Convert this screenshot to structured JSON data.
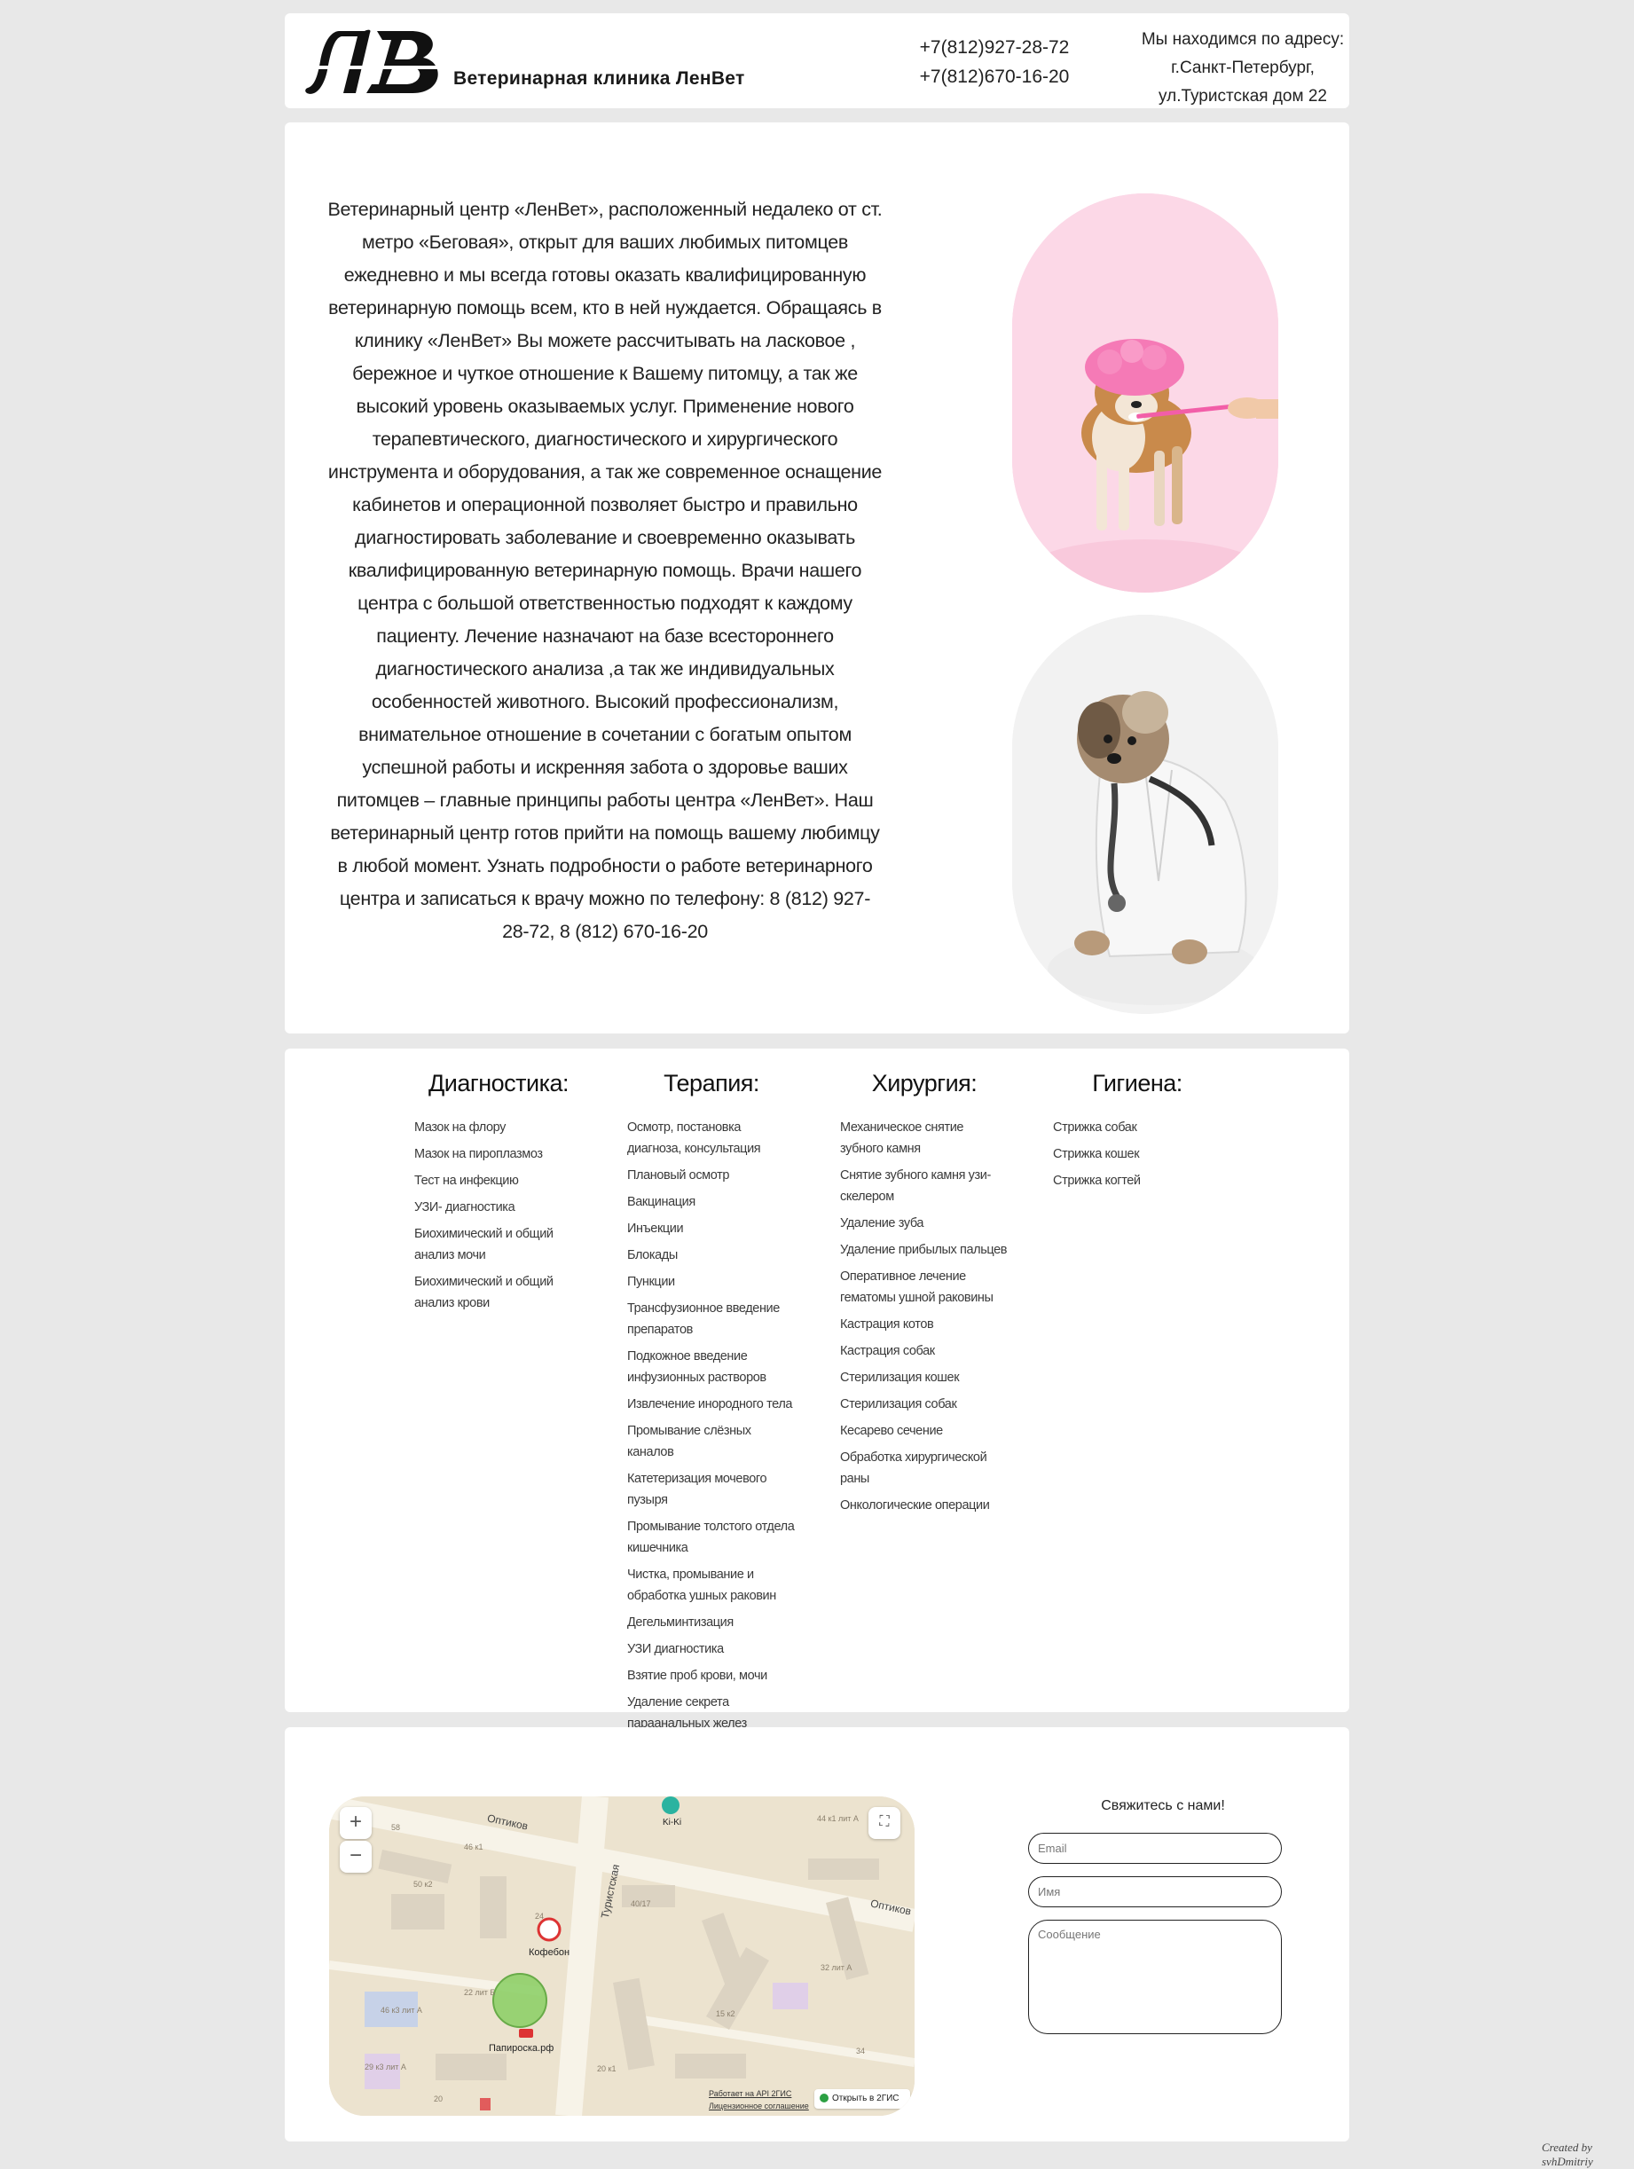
{
  "header": {
    "logo_letters": "ЛВ",
    "clinic_name": "Ветеринарная клиника ЛенВет",
    "phones": [
      "+7(812)927-28-72",
      "+7(812)670-16-20"
    ],
    "address": [
      "Мы находимся по адресу:",
      "г.Санкт-Петербург,",
      "ул.Туристская дом 22"
    ]
  },
  "about": {
    "text": "Ветеринарный центр «ЛенВет», расположенный недалеко от ст. метро «Беговая», открыт для ваших любимых питомцев ежедневно и мы всегда готовы оказать квалифицированную ветеринарную помощь всем, кто в ней нуждается. Обращаясь в клинику «ЛенВет» Вы можете рассчитывать на ласковое , бережное и чуткое отношение к Вашему питомцу, а так же высокий уровень оказываемых услуг. Применение нового терапевтического, диагностического и хирургического инструмента и оборудования, а так же современное оснащение кабинетов и операционной позволяет быстро и правильно диагностировать заболевание и своевременно оказывать квалифицированную ветеринарную помощь. Врачи нашего центра с большой ответственностью подходят к каждому пациенту. Лечение назначают на базе всестороннего диагностического анализа ,а так же индивидуальных особенностей животного. Высокий профессионализм, внимательное отношение в сочетании с богатым опытом успешной работы и искренняя забота о здоровье ваших питомцев – главные принципы работы центра «ЛенВет». Наш ветеринарный центр готов прийти на помощь вашему любимцу в любой момент. Узнать подробности о работе ветеринарного центра и записаться к врачу можно по телефону: 8 (812) 927-28-72, 8 (812) 670-16-20",
    "images": [
      "dog-brushing-teeth",
      "dog-in-doctor-coat"
    ]
  },
  "services": [
    {
      "title": "Диагностика:",
      "items": [
        "Мазок на флору",
        "Мазок на пироплазмоз",
        "Тест на инфекцию",
        "УЗИ- диагностика",
        "Биохимический и общий анализ мочи",
        "Биохимический и общий анализ крови"
      ]
    },
    {
      "title": "Терапия:",
      "items": [
        "Осмотр, постановка диагноза, консультация",
        "Плановый осмотр",
        "Вакцинация",
        "Инъекции",
        "Блокады",
        "Пункции",
        "Трансфузионное введение препаратов",
        "Подкожное введение инфузионных растворов",
        "Извлечение инородного тела",
        "Промывание слёзных каналов",
        "Катетеризация мочевого пузыря",
        "Промывание толстого отдела кишечника",
        "Чистка, промывание и обработка ушных раковин",
        "Дегельминтизация",
        "УЗИ диагностика",
        "Взятие проб крови, мочи",
        "Удаление секрета параанальных желез"
      ]
    },
    {
      "title": "Хирургия:",
      "items": [
        "Механическое снятие зубного камня",
        "Снятие зубного камня узи-скелером",
        "Удаление зуба",
        "Удаление прибылых пальцев",
        "Оперативное лечение гематомы ушной раковины",
        "Кастрация котов",
        "Кастрация собак",
        "Стерилизация кошек",
        "Стерилизация собак",
        "Кесарево сечение",
        "Обработка хирургической раны",
        "Онкологические операции"
      ]
    },
    {
      "title": "Гигиена:",
      "items": [
        "Стрижка собак",
        "Стрижка кошек",
        "Стрижка когтей"
      ]
    }
  ],
  "map": {
    "zoom_in": "+",
    "zoom_out": "−",
    "streets": [
      "Оптиков",
      "Оптиков",
      "Туристская"
    ],
    "places": [
      "Ki-Ki",
      "Кофебон",
      "Папироска.рф"
    ],
    "house_labels": [
      "58",
      "46 к1",
      "50 к2",
      "24",
      "40/17",
      "22 лит Б",
      "46 к3 лит А",
      "29 к3 лит А",
      "20",
      "15 к2",
      "44 к1 лит А",
      "32 лит А",
      "20 к1",
      "34"
    ],
    "footer_api": "Работает на API 2ГИС",
    "footer_license": "Лицензионное соглашение",
    "open_label": "Открыть в 2ГИС",
    "colors": {
      "road": "#f7f3e8",
      "block": "#ece3cf",
      "building": "#dcd3c2",
      "marker": "#8fd16a"
    }
  },
  "contact_form": {
    "title": "Свяжитесь с нами!",
    "email_placeholder": "Email",
    "name_placeholder": "Имя",
    "message_placeholder": "Сообщение"
  },
  "credit": "Created by svhDmitriy"
}
